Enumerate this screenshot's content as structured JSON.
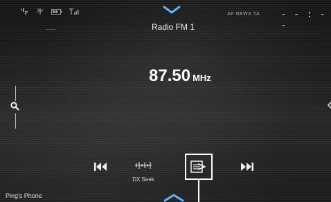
{
  "status_bar": {
    "icons": [
      "phone-signal-icon",
      "bluetooth-audio-icon",
      "battery-icon",
      "signal-strength-icon"
    ],
    "rds_indicators": "AF  NEWS TA",
    "clock": "- - : - -"
  },
  "header": {
    "source_title": "Radio FM 1"
  },
  "tuner": {
    "frequency": "87.50",
    "unit": "MHz"
  },
  "controls": {
    "prev_icon": "skip-back-icon",
    "dx_seek_label": "DX Seek",
    "band_icon": "preset-band-switch-icon",
    "next_icon": "skip-forward-icon"
  },
  "footer": {
    "phone_name": "Ping's Phone"
  },
  "colors": {
    "background": "#1c1c1c",
    "text": "#ffffff",
    "callout": "#ffffff"
  }
}
